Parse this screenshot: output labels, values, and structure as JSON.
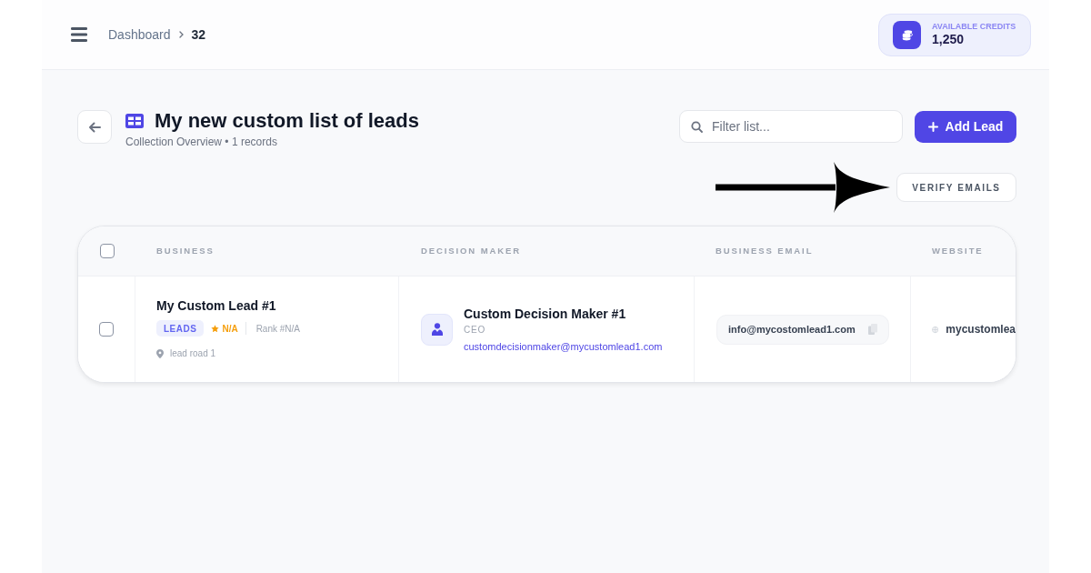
{
  "header": {
    "breadcrumbs": [
      {
        "label": "Dashboard",
        "current": false
      },
      {
        "label": "32",
        "current": true
      }
    ],
    "credits": {
      "label": "AVAILABLE CREDITS",
      "value": "1,250"
    }
  },
  "page": {
    "title": "My new custom list of leads",
    "subtitle": "Collection Overview • 1 records",
    "filter": {
      "placeholder": "Filter list..."
    },
    "add_button": {
      "label": "Add Lead"
    },
    "verify_button": {
      "label": "VERIFY EMAILS"
    }
  },
  "table": {
    "select_all": {
      "checked": false
    },
    "columns": [
      "BUSINESS",
      "DECISION MAKER",
      "BUSINESS EMAIL",
      "WEBSITE"
    ],
    "rows": [
      {
        "checked": false,
        "business": {
          "name": "My Custom Lead #1",
          "tag": "LEADS",
          "rating": "N/A",
          "rank": "Rank #N/A",
          "address": "lead road 1"
        },
        "decision_maker": {
          "name": "Custom Decision Maker #1",
          "title": "CEO",
          "email": "customdecisionmaker@mycustomlead1.com"
        },
        "business_email": "info@mycostomlead1.com",
        "website": "mycustomlea"
      }
    ]
  }
}
